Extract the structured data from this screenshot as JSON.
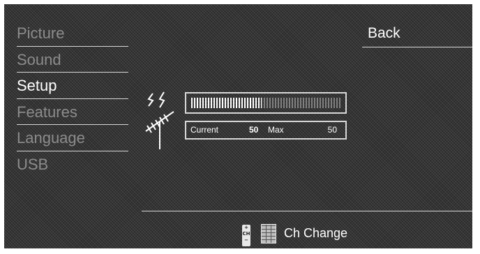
{
  "menu": {
    "items": [
      {
        "label": "Picture",
        "active": false
      },
      {
        "label": "Sound",
        "active": false
      },
      {
        "label": "Setup",
        "active": true
      },
      {
        "label": "Features",
        "active": false
      },
      {
        "label": "Language",
        "active": false
      },
      {
        "label": "USB",
        "active": false
      }
    ]
  },
  "back_label": "Back",
  "signal": {
    "current_label": "Current",
    "current_value": "50",
    "max_label": "Max",
    "max_value": "50",
    "level_fraction": 0.47
  },
  "footer": {
    "ch_icon_text": [
      "+",
      "CH",
      "−"
    ],
    "ch_change_label": "Ch Change"
  },
  "colors": {
    "active_text": "#ffffff",
    "inactive_text": "#8c8c8c",
    "separator": "#d8d8d8",
    "background": "#2a2a2a"
  },
  "icons": [
    "antenna-signal-icon",
    "channel-button-icon",
    "keypad-icon"
  ]
}
